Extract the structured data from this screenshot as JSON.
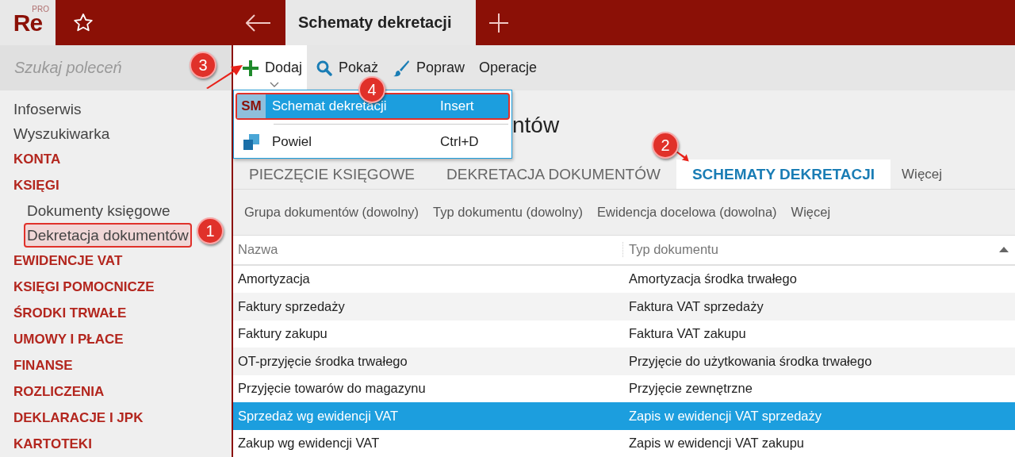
{
  "app": {
    "logo": "Re",
    "logo_badge": "PRO"
  },
  "window_tabs": [
    {
      "label": "Schematy dekretacji",
      "selected": true
    }
  ],
  "sidebar": {
    "search": {
      "placeholder": "Szukaj poleceń"
    },
    "items": [
      {
        "kind": "link",
        "label": "Infoserwis"
      },
      {
        "kind": "link",
        "label": "Wyszukiwarka"
      },
      {
        "kind": "section",
        "label": "KONTA"
      },
      {
        "kind": "section",
        "label": "KSIĘGI",
        "children": [
          {
            "label": "Dokumenty księgowe",
            "highlighted": false
          },
          {
            "label": "Dekretacja dokumentów",
            "highlighted": true
          }
        ]
      },
      {
        "kind": "section",
        "label": "EWIDENCJE VAT"
      },
      {
        "kind": "section",
        "label": "KSIĘGI POMOCNICZE"
      },
      {
        "kind": "section",
        "label": "ŚRODKI TRWAŁE"
      },
      {
        "kind": "section",
        "label": "UMOWY I PŁACE"
      },
      {
        "kind": "section",
        "label": "FINANSE"
      },
      {
        "kind": "section",
        "label": "ROZLICZENIA"
      },
      {
        "kind": "section",
        "label": "DEKLARACJE I JPK"
      },
      {
        "kind": "section",
        "label": "KARTOTEKI"
      }
    ]
  },
  "toolbar": [
    {
      "kind": "add",
      "label": "Dodaj",
      "expanded": true
    },
    {
      "kind": "search",
      "label": "Pokaż",
      "expanded": false
    },
    {
      "kind": "brush",
      "label": "Popraw",
      "expanded": false
    },
    {
      "kind": "plain",
      "label": "Operacje",
      "expanded": false
    }
  ],
  "add_menu": [
    {
      "icon": "SM",
      "label": "Schemat dekretacji",
      "shortcut": "Insert",
      "selected": true
    },
    {
      "label": "Powiel",
      "shortcut": "Ctrl+D",
      "selected": false
    }
  ],
  "page_title": "ntów",
  "tabs": [
    {
      "label": "PIECZĘCIE KSIĘGOWE",
      "selected": false
    },
    {
      "label": "DEKRETACJA DOKUMENTÓW",
      "selected": false
    },
    {
      "label": "SCHEMATY DEKRETACJI",
      "selected": true
    }
  ],
  "tabs_more": "Więcej",
  "filters": [
    "Grupa dokumentów (dowolny)",
    "Typ dokumentu (dowolny)",
    "Ewidencja docelowa (dowolna)",
    "Więcej"
  ],
  "table": {
    "columns": [
      "Nazwa",
      "Typ dokumentu"
    ],
    "rows": [
      {
        "cells": [
          "Amortyzacja",
          "Amortyzacja środka trwałego"
        ],
        "selected": false
      },
      {
        "cells": [
          "Faktury sprzedaży",
          "Faktura VAT sprzedaży"
        ],
        "selected": false
      },
      {
        "cells": [
          "Faktury zakupu",
          "Faktura VAT zakupu"
        ],
        "selected": false
      },
      {
        "cells": [
          "OT-przyjęcie środka trwałego",
          "Przyjęcie do użytkowania środka trwałego"
        ],
        "selected": false
      },
      {
        "cells": [
          "Przyjęcie towarów do magazynu",
          "Przyjęcie zewnętrzne"
        ],
        "selected": false
      },
      {
        "cells": [
          "Sprzedaż wg ewidencji VAT",
          "Zapis w ewidencji VAT sprzedaży"
        ],
        "selected": true
      },
      {
        "cells": [
          "Zakup wg ewidencji VAT",
          "Zapis w ewidencji VAT zakupu"
        ],
        "selected": false
      }
    ]
  },
  "annotations": [
    {
      "label": "1"
    },
    {
      "label": "2"
    },
    {
      "label": "3"
    },
    {
      "label": "4"
    }
  ]
}
